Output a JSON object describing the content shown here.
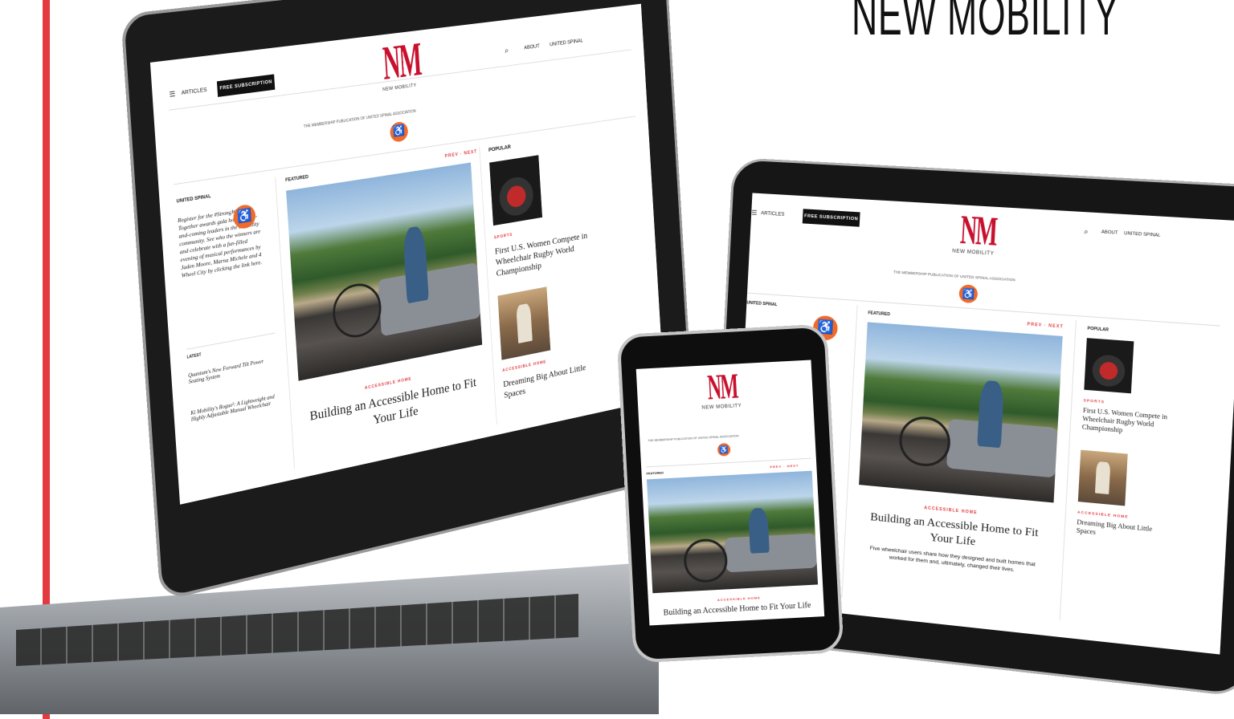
{
  "brand": {
    "title": "NEW MOBILITY",
    "accent": "#e23a3f",
    "logo_letters": "NM",
    "logo_word": "NEW MOBILITY"
  },
  "site": {
    "nav": {
      "articles": "ARTICLES",
      "subscribe": "FREE SUBSCRIPTION",
      "about": "ABOUT",
      "united_spinal": "UNITED SPINAL"
    },
    "tagline": "THE MEMBERSHIP PUBLICATION OF UNITED SPINAL ASSOCIATION",
    "sidebar": {
      "section": "UNITED SPINAL",
      "blurb": "Register for the #StrongWheeled Together awards gala honoring up-and-coming leaders in the disability community. See who the winners are and celebrate with a fun-filled evening of musical performances by Jaden Moore, Marna Michele and 4 Wheel City by clicking the link here.",
      "latest_label": "LATEST",
      "latest": [
        "Quantum's New Forward Tilt Power Seating System",
        "Ki Mobility's Rogue²: A Lightweight and Highly Adjustable Manual Wheelchair"
      ]
    },
    "featured": {
      "label": "FEATURED",
      "prev_next": "PREV · NEXT",
      "kicker": "ACCESSIBLE HOME",
      "headline": "Building an Accessible Home to Fit Your Life",
      "dek": "Five wheelchair users share how they designed and built homes that worked for them and, ultimately, changed their lives."
    },
    "popular": {
      "label": "POPULAR",
      "items": [
        {
          "kicker": "SPORTS",
          "headline": "First U.S. Women Compete in Wheelchair Rugby World Championship"
        },
        {
          "kicker": "ACCESSIBLE HOME",
          "headline": "Dreaming Big About Little Spaces"
        }
      ]
    }
  }
}
